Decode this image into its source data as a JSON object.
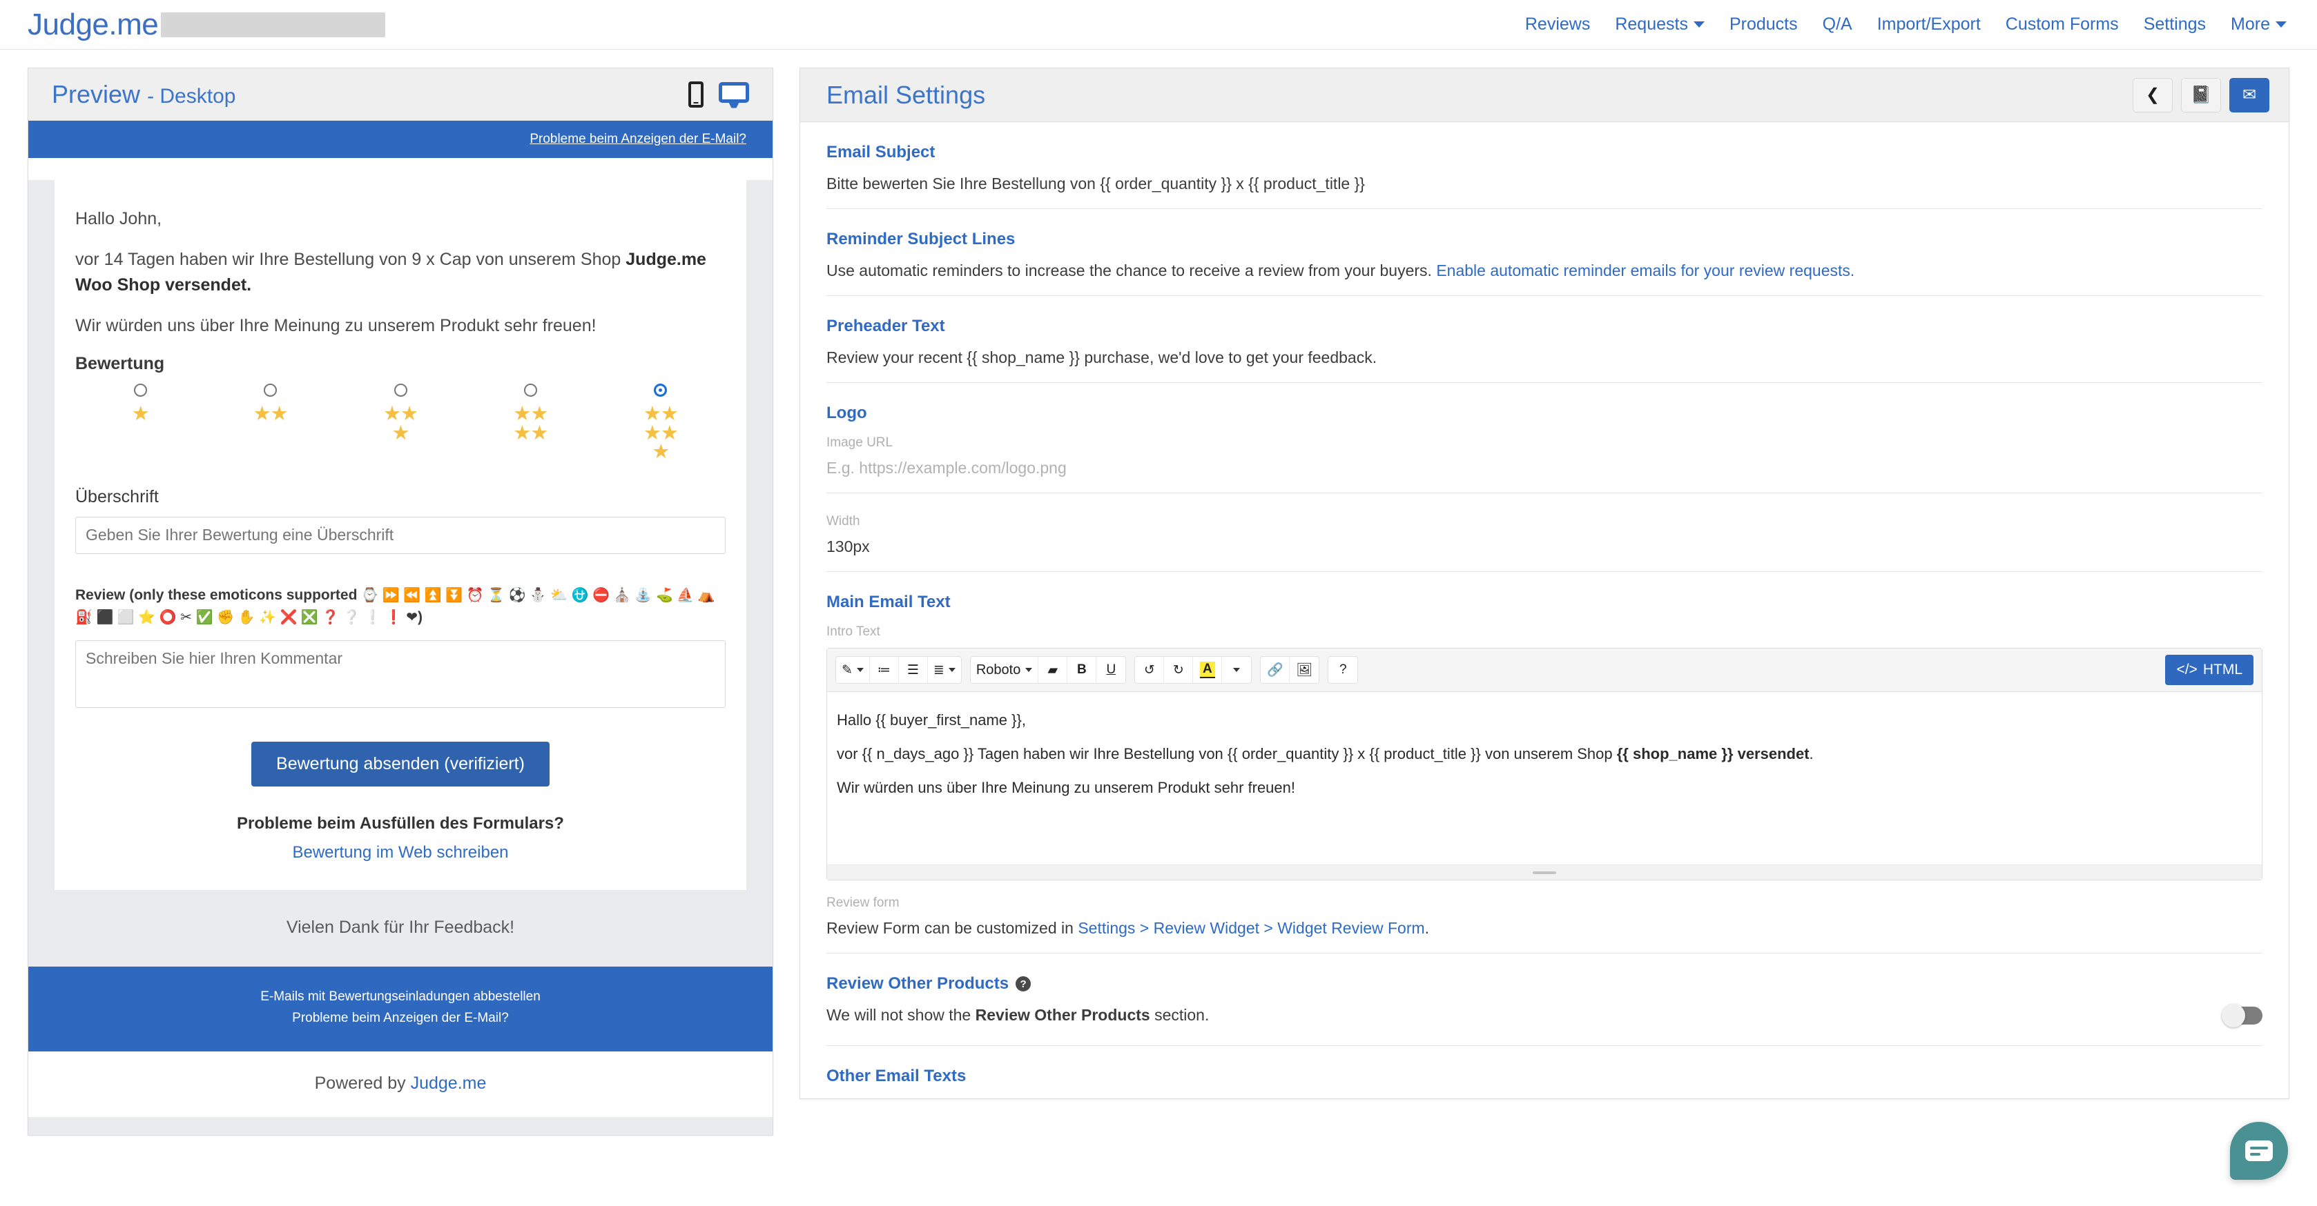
{
  "nav": {
    "brand": "Judge.me",
    "links": [
      {
        "label": "Reviews",
        "caret": false
      },
      {
        "label": "Requests",
        "caret": true
      },
      {
        "label": "Products",
        "caret": false
      },
      {
        "label": "Q/A",
        "caret": false
      },
      {
        "label": "Import/Export",
        "caret": false
      },
      {
        "label": "Custom Forms",
        "caret": false
      },
      {
        "label": "Settings",
        "caret": false
      },
      {
        "label": "More",
        "caret": true
      }
    ]
  },
  "preview": {
    "title": "Preview",
    "subtitle": "- Desktop",
    "device_phone": "mobile-preview",
    "device_desktop": "desktop-preview",
    "top_link": "Probleme beim Anzeigen der E-Mail?",
    "greeting": "Hallo John,",
    "intro_plain_1": "vor 14 Tagen haben wir Ihre Bestellung von 9 x Cap von unserem Shop ",
    "intro_bold": "Judge.me Woo Shop versendet.",
    "intro_line3": "Wir würden uns über Ihre Meinung zu unserem Produkt sehr freuen!",
    "rating_label": "Bewertung",
    "rating_options": [
      1,
      2,
      3,
      4,
      5
    ],
    "rating_selected": 5,
    "title_label": "Überschrift",
    "title_placeholder": "Geben Sie Ihrer Bewertung eine Überschrift",
    "review_label_text": "Review (only these emoticons supported ",
    "review_emojis_line1": "⌚ ⏩ ⏪ ⏫ ⏬ ⏰ ⏳ ⚽ ⛄ ⛅ ⛎ ⛔ ⛪ ⛲",
    "review_emojis_line2": "⛳ ⛵ ⛺ ⛽ ⬛ ⬜ ⭐ ⭕ ✂ ✅ ✊ ✋ ✨ ❌ ❎ ❓ ❔ ❕ ❗ ❤",
    "review_label_close": ")",
    "comment_placeholder": "Schreiben Sie hier Ihren Kommentar",
    "submit_label": "Bewertung absenden (verifiziert)",
    "form_problem_title": "Probleme beim Ausfüllen des Formulars?",
    "form_problem_link": "Bewertung im Web schreiben",
    "thanks": "Vielen Dank für Ihr Feedback!",
    "footer_link_1": "E-Mails mit Bewertungseinladungen abbestellen",
    "footer_link_2": "Probleme beim Anzeigen der E-Mail?",
    "powered_prefix": "Powered by ",
    "powered_brand": "Judge.me"
  },
  "settings": {
    "title": "Email Settings",
    "head_buttons": [
      {
        "name": "back-button",
        "glyph": "❮",
        "primary": false
      },
      {
        "name": "manual-button",
        "glyph": "📓",
        "primary": false
      },
      {
        "name": "send-test-email-button",
        "glyph": "✉",
        "primary": true
      }
    ],
    "email_subject": {
      "heading": "Email Subject",
      "value": "Bitte bewerten Sie Ihre Bestellung von {{ order_quantity }} x {{ product_title }}"
    },
    "reminder_subject": {
      "heading": "Reminder Subject Lines",
      "text": "Use automatic reminders to increase the chance to receive a review from your buyers. ",
      "link": "Enable automatic reminder emails for your review requests."
    },
    "preheader": {
      "heading": "Preheader Text",
      "value": "Review your recent {{ shop_name }} purchase, we'd love to get your feedback."
    },
    "logo": {
      "heading": "Logo",
      "image_url_label": "Image URL",
      "image_url_placeholder": "E.g. https://example.com/logo.png",
      "width_label": "Width",
      "width_value": "130px"
    },
    "main_email_text": {
      "heading": "Main Email Text",
      "intro_label": "Intro Text",
      "toolbar": {
        "format_painter": "✎",
        "ordered_list": "≔",
        "unordered_list": "☰",
        "align": "≣",
        "font_name": "Roboto",
        "eraser": "▰",
        "bold": "B",
        "underline": "U",
        "undo": "↺",
        "redo": "↻",
        "text_color": "A",
        "link": "🔗",
        "image": "🖼",
        "help": "?",
        "html_label": "HTML"
      },
      "body_line1": "Hallo {{ buyer_first_name }},",
      "body_line2_plain": "vor {{ n_days_ago }} Tagen haben wir Ihre Bestellung von {{ order_quantity }} x {{ product_title }} von unserem Shop ",
      "body_line2_bold": "{{ shop_name }} versendet",
      "body_line2_end": ".",
      "body_line3": "Wir würden uns über Ihre Meinung zu unserem Produkt sehr freuen!"
    },
    "review_form": {
      "label": "Review form",
      "text_prefix": "Review Form can be customized in ",
      "link": "Settings > Review Widget > Widget Review Form",
      "text_suffix": "."
    },
    "review_other_products": {
      "heading": "Review Other Products",
      "help_glyph": "?",
      "text_prefix": "We will not show the ",
      "text_bold": "Review Other Products",
      "text_suffix": " section.",
      "toggle_on": false
    },
    "other_email_texts": {
      "heading": "Other Email Texts"
    }
  },
  "colors": {
    "brand_blue": "#2f6ac4",
    "email_bar_blue": "#2f68bf",
    "star_gold": "#f5bf42",
    "chat_teal": "#4a9193"
  }
}
